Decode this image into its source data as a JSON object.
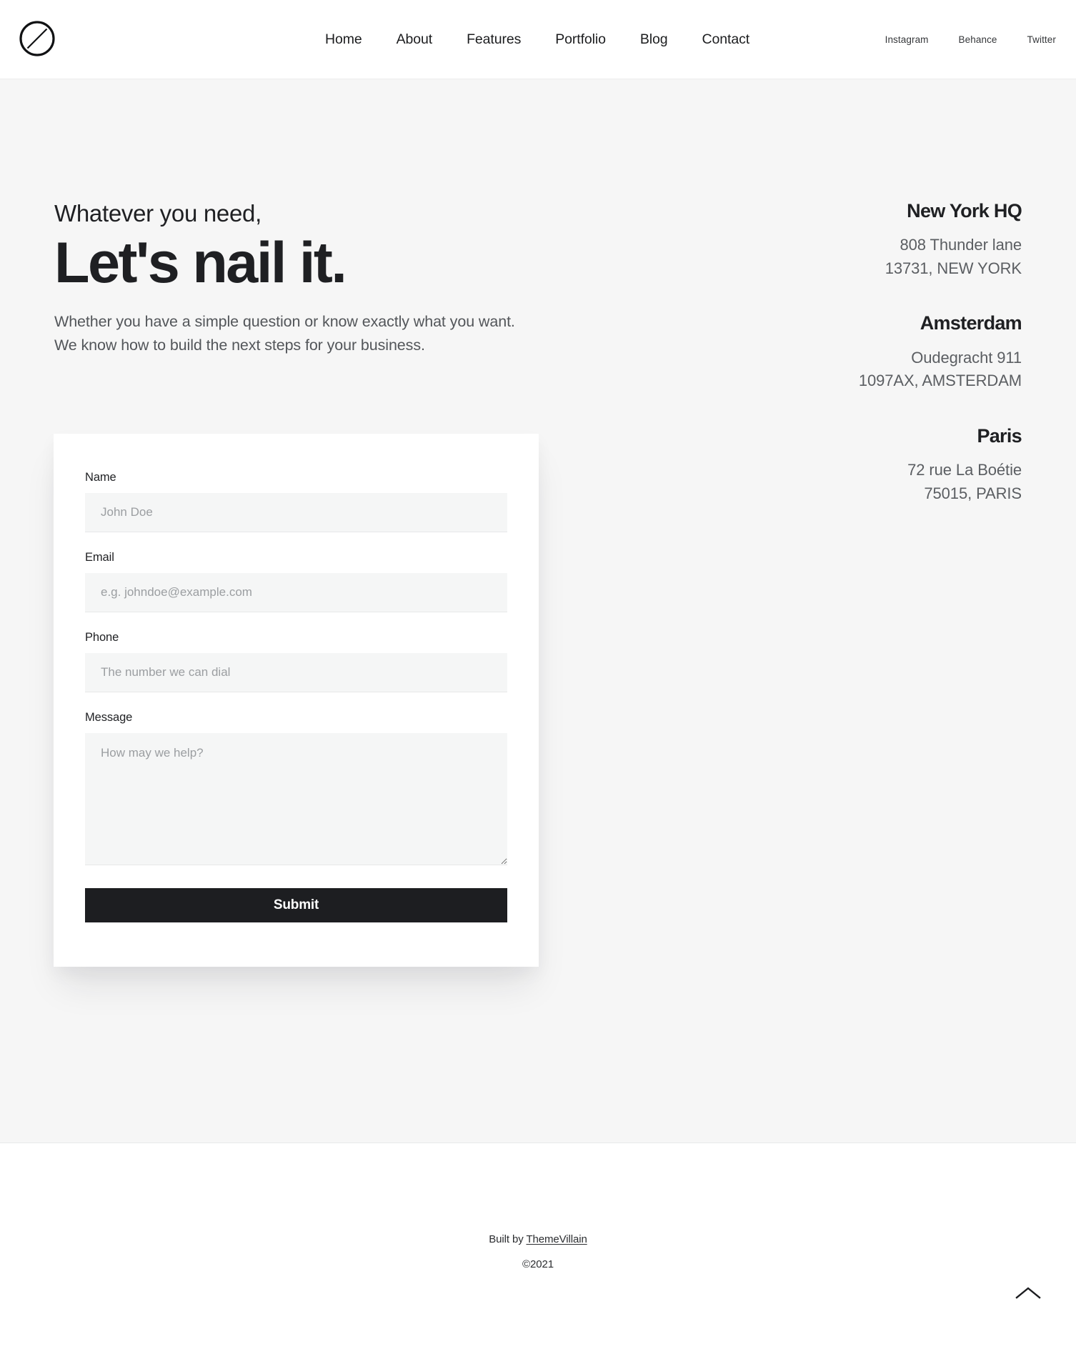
{
  "header": {
    "logo_icon": "circle-slash-logo-icon",
    "nav": [
      {
        "label": "Home"
      },
      {
        "label": "About"
      },
      {
        "label": "Features"
      },
      {
        "label": "Portfolio"
      },
      {
        "label": "Blog"
      },
      {
        "label": "Contact"
      }
    ],
    "social": [
      {
        "label": "Instagram"
      },
      {
        "label": "Behance"
      },
      {
        "label": "Twitter"
      }
    ]
  },
  "contact": {
    "eyebrow": "Whatever you need,",
    "title": "Let's nail it.",
    "description": "Whether you have a simple question or know exactly what you want. We know how to build the next steps for your business.",
    "form": {
      "name": {
        "label": "Name",
        "placeholder": "John Doe",
        "value": ""
      },
      "email": {
        "label": "Email",
        "placeholder": "e.g. johndoe@example.com",
        "value": ""
      },
      "phone": {
        "label": "Phone",
        "placeholder": "The number we can dial",
        "value": ""
      },
      "message": {
        "label": "Message",
        "placeholder": "How may we help?",
        "value": ""
      },
      "submit_label": "Submit"
    },
    "addresses": [
      {
        "city": "New York HQ",
        "line1": "808 Thunder lane",
        "line2": "13731, NEW YORK"
      },
      {
        "city": "Amsterdam",
        "line1": "Oudegracht 911",
        "line2": "1097AX, AMSTERDAM"
      },
      {
        "city": "Paris",
        "line1": "72 rue La Boétie",
        "line2": "75015, PARIS"
      }
    ]
  },
  "footer": {
    "credit_prefix": "Built by ",
    "credit_link": "ThemeVillain",
    "copyright": "©2021",
    "scroll_top_icon": "chevron-up-icon"
  },
  "colors": {
    "page_background": "#ffffff",
    "section_background": "#f6f6f6",
    "card_background": "#ffffff",
    "input_background": "#f5f6f6",
    "text_primary": "#1f2023",
    "text_secondary": "#5b5e62",
    "placeholder": "#9b9ea1",
    "submit_background": "#1d1e21",
    "submit_text": "#ffffff"
  }
}
